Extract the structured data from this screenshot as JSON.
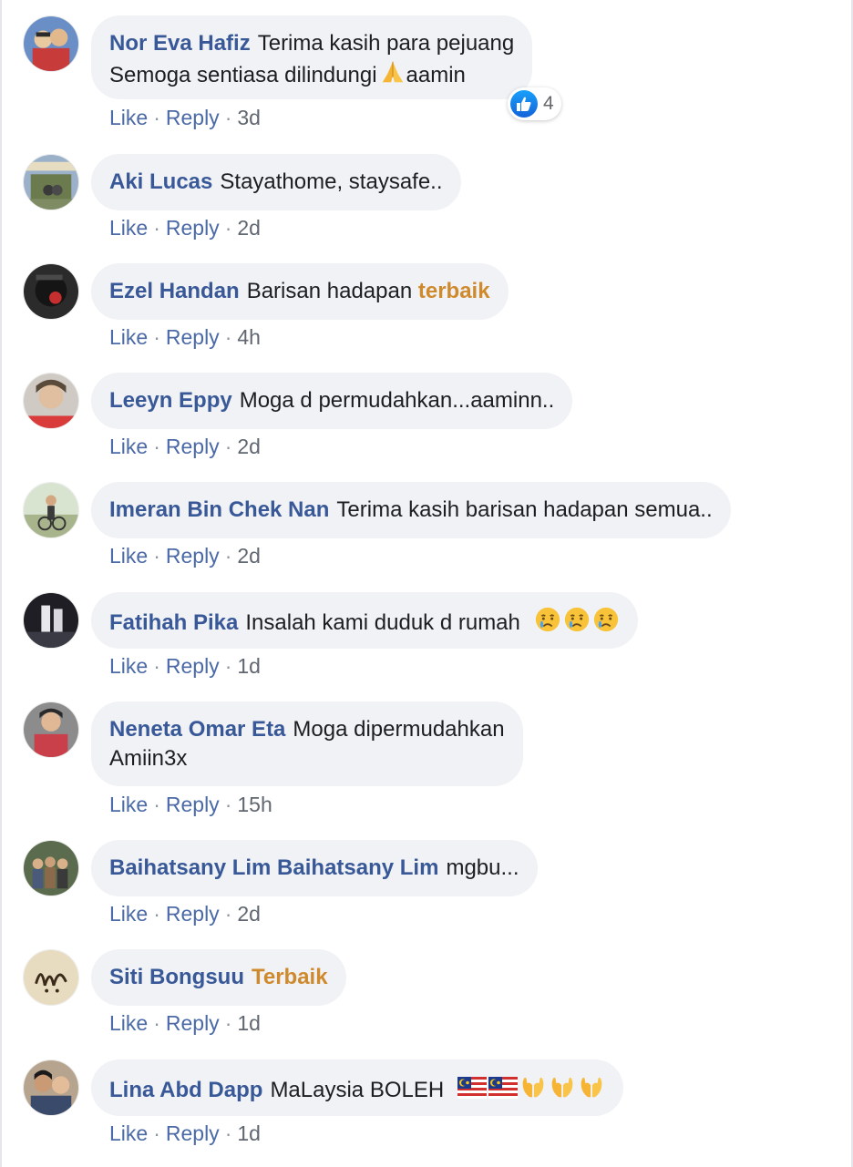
{
  "actions": {
    "like": "Like",
    "reply": "Reply",
    "separator": "·"
  },
  "colors": {
    "author": "#385898",
    "highlight": "#d08a2e",
    "bubble": "#f0f2f5",
    "like_blue": "#1877f2"
  },
  "comments": [
    {
      "author": "Nor Eva Hafiz",
      "line1": "Terima kasih para pejuang",
      "line2a": "Semoga sentiasa dilindungi",
      "emoji2": "folded-hands",
      "line2b": "aamin",
      "time": "3d",
      "reaction_count": "4"
    },
    {
      "author": "Aki Lucas",
      "text": "Stayathome, staysafe..",
      "time": "2d"
    },
    {
      "author": "Ezel Handan",
      "text": "Barisan hadapan",
      "highlight": "terbaik",
      "time": "4h"
    },
    {
      "author": "Leeyn Eppy",
      "text": "Moga d permudahkan...aaminn..",
      "time": "2d"
    },
    {
      "author": "Imeran Bin Chek Nan",
      "text": "Terima kasih barisan hadapan semua..",
      "time": "2d"
    },
    {
      "author": "Fatihah Pika",
      "text": "Insalah kami duduk d rumah",
      "emojis": [
        "crying-face",
        "crying-face",
        "crying-face"
      ],
      "time": "1d"
    },
    {
      "author": "Neneta Omar Eta",
      "line1": "Moga dipermudahkan",
      "line2": "Amiin3x",
      "time": "15h"
    },
    {
      "author": "Baihatsany Lim Baihatsany Lim",
      "text": "mgbu...",
      "time": "2d"
    },
    {
      "author": "Siti Bongsuu",
      "highlight": "Terbaik",
      "time": "1d"
    },
    {
      "author": "Lina Abd Dapp",
      "text": "MaLaysia BOLEH",
      "emojis": [
        "malaysia-flag",
        "malaysia-flag",
        "open-hands",
        "open-hands",
        "open-hands"
      ],
      "time": "1d"
    }
  ]
}
